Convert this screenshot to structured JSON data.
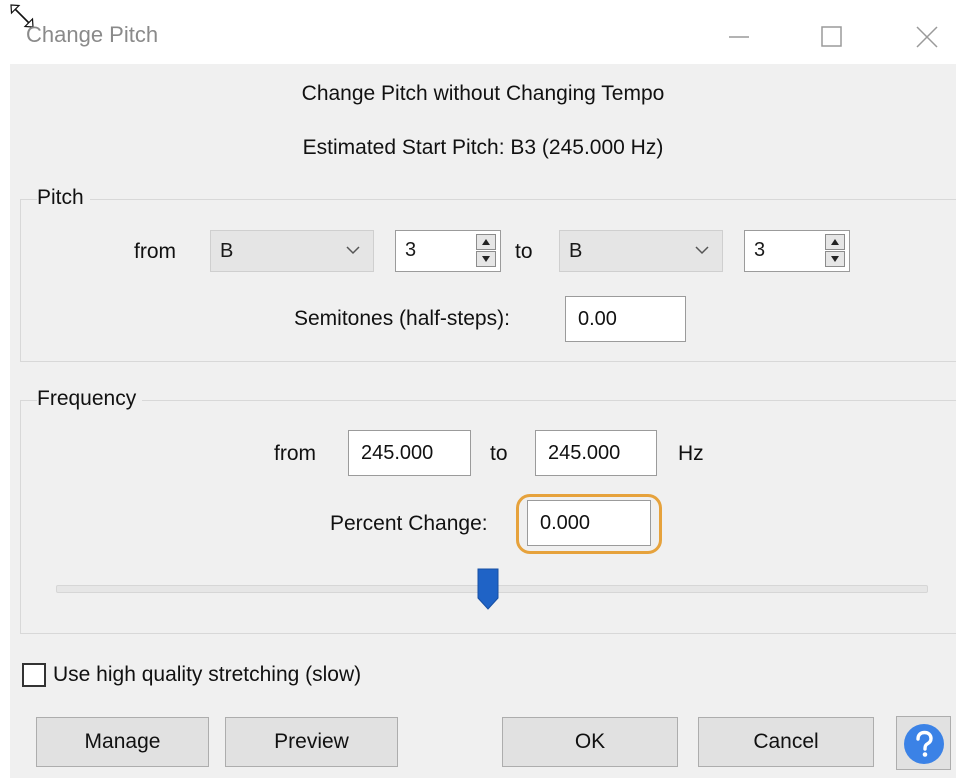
{
  "window": {
    "title": "Change Pitch"
  },
  "dialog": {
    "heading": "Change Pitch without Changing Tempo",
    "estimated_pitch": "Estimated Start Pitch: B3 (245.000 Hz)"
  },
  "pitch": {
    "legend": "Pitch",
    "from_label": "from",
    "from_note": "B",
    "from_octave": "3",
    "to_label": "to",
    "to_note": "B",
    "to_octave": "3",
    "semitones_label": "Semitones (half-steps):",
    "semitones_value": "0.00"
  },
  "frequency": {
    "legend": "Frequency",
    "from_label": "from",
    "from_value": "245.000",
    "to_label": "to",
    "to_value": "245.000",
    "unit": "Hz",
    "percent_label": "Percent Change:",
    "percent_value": "0.000",
    "slider_position": 0.5
  },
  "options": {
    "high_quality_label": "Use high quality stretching (slow)",
    "high_quality_checked": false
  },
  "buttons": {
    "manage": "Manage",
    "preview": "Preview",
    "ok": "OK",
    "cancel": "Cancel",
    "help_icon": "help-icon"
  },
  "colors": {
    "highlight": "#e6a23c",
    "thumb": "#1f63c6",
    "help": "#3b82e6"
  }
}
